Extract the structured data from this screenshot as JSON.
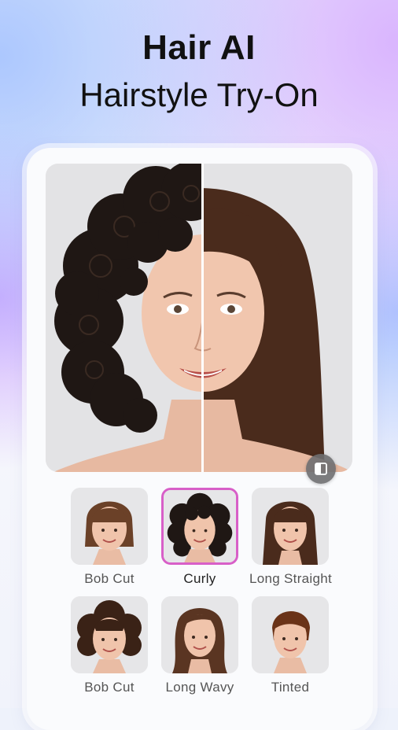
{
  "headline": {
    "line1": "Hair AI",
    "line2": "Hairstyle Try-On"
  },
  "preview": {
    "compare_icon": "compare-split-icon"
  },
  "styles": [
    {
      "label": "Bob Cut",
      "selected": false,
      "hair_color": "#6b4128"
    },
    {
      "label": "Curly",
      "selected": true,
      "hair_color": "#1f1714"
    },
    {
      "label": "Long Straight",
      "selected": false,
      "hair_color": "#4a2b1c"
    },
    {
      "label": "Bob Cut",
      "selected": false,
      "hair_color": "#3a2216"
    },
    {
      "label": "Long Wavy",
      "selected": false,
      "hair_color": "#5a3522"
    },
    {
      "label": "Tinted",
      "selected": false,
      "hair_color": "#6a3318"
    }
  ],
  "colors": {
    "accent": "#d85fc8",
    "text": "#111111",
    "label": "#555555"
  }
}
